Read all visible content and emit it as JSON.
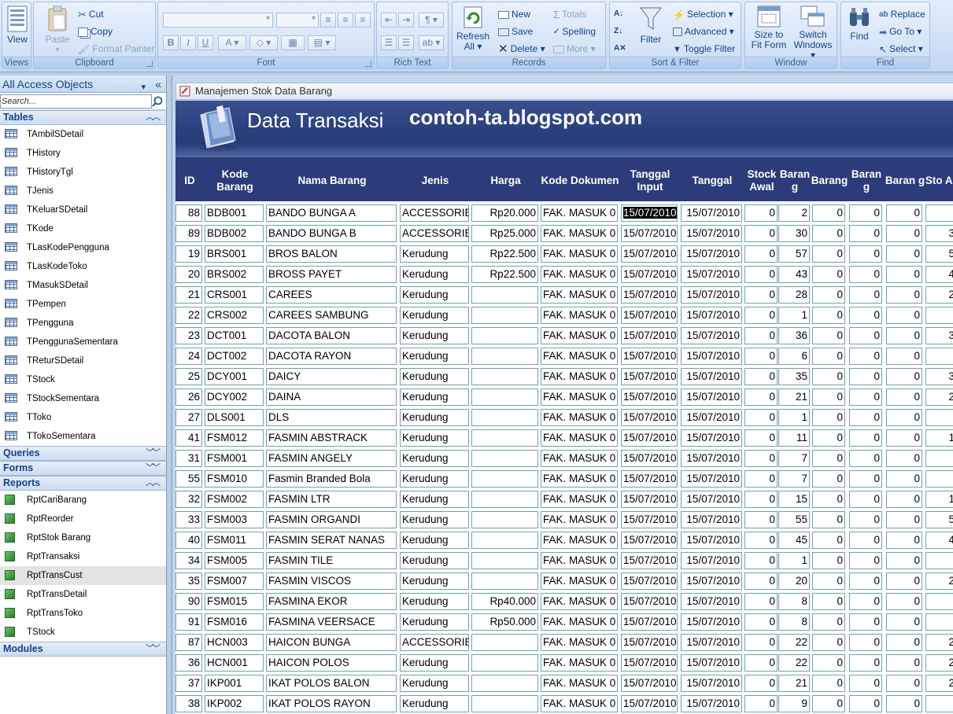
{
  "ribbon": {
    "views": {
      "label": "Views",
      "view_label": "View"
    },
    "clipboard": {
      "label": "Clipboard",
      "paste": "Paste",
      "cut": "Cut",
      "copy": "Copy",
      "format_painter": "Format Painter"
    },
    "font": {
      "label": "Font"
    },
    "rich_text": {
      "label": "Rich Text"
    },
    "records": {
      "label": "Records",
      "refresh": "Refresh",
      "refresh_sub": "All",
      "new": "New",
      "save": "Save",
      "delete": "Delete",
      "totals": "Totals",
      "spelling": "Spelling",
      "more": "More"
    },
    "sort_filter": {
      "label": "Sort & Filter",
      "filter": "Filter",
      "selection": "Selection",
      "advanced": "Advanced",
      "toggle_filter": "Toggle Filter"
    },
    "window": {
      "label": "Window",
      "size_to_fit": "Size to",
      "size_to_fit_2": "Fit Form",
      "switch_windows": "Switch",
      "switch_windows_2": "Windows"
    },
    "find": {
      "label": "Find",
      "find": "Find",
      "replace": "Replace",
      "go_to": "Go To",
      "select": "Select"
    }
  },
  "nav": {
    "header": "All Access Objects",
    "search_placeholder": "Search...",
    "sections": {
      "tables": "Tables",
      "queries": "Queries",
      "forms": "Forms",
      "reports": "Reports",
      "modules": "Modules"
    },
    "tables": [
      "TAmbilSDetail",
      "THistory",
      "THistoryTgl",
      "TJenis",
      "TKeluarSDetail",
      "TKode",
      "TLasKodePengguna",
      "TLasKodeToko",
      "TMasukSDetail",
      "TPempen",
      "TPengguna",
      "TPenggunaSementara",
      "TReturSDetail",
      "TStock",
      "TStockSementara",
      "TToko",
      "TTokoSementara"
    ],
    "reports": [
      "RptCariBarang",
      "RptReorder",
      "RptStok Barang",
      "RptTransaksi",
      "RptTransCust",
      "RptTransDetail",
      "RptTransToko",
      "TStock"
    ],
    "selected_report": "RptTransCust"
  },
  "doc": {
    "tab_title": "Manajemen Stok Data Barang",
    "form_title": "Data Transaksi",
    "form_subtitle": "contoh-ta.blogspot.com"
  },
  "grid": {
    "columns": [
      {
        "key": "id",
        "label": "ID"
      },
      {
        "key": "kode",
        "label": "Kode Barang"
      },
      {
        "key": "nama",
        "label": "Nama Barang"
      },
      {
        "key": "jenis",
        "label": "Jenis"
      },
      {
        "key": "harga",
        "label": "Harga"
      },
      {
        "key": "dok",
        "label": "Kode Dokumen"
      },
      {
        "key": "tgl_input",
        "label": "Tanggal Input"
      },
      {
        "key": "tgl",
        "label": "Tanggal"
      },
      {
        "key": "stock_awal",
        "label": "Stock Awal"
      },
      {
        "key": "barang1",
        "label": "Baran g"
      },
      {
        "key": "barang2",
        "label": "Barang"
      },
      {
        "key": "barang3",
        "label": "Baran g"
      },
      {
        "key": "barang4",
        "label": "Baran g"
      },
      {
        "key": "stock_akhir",
        "label": "Sto Ak"
      }
    ],
    "rows": [
      {
        "id": "88",
        "kode": "BDB001",
        "nama": "BANDO BUNGA A",
        "jenis": "ACCESSORIE",
        "harga": "Rp20.000",
        "dok": "FAK. MASUK 0",
        "tgl_input": "15/07/2010",
        "tgl": "15/07/2010",
        "stock_awal": "0",
        "barang1": "2",
        "barang2": "0",
        "barang3": "0",
        "barang4": "0",
        "stock_akhir": ""
      },
      {
        "id": "89",
        "kode": "BDB002",
        "nama": "BANDO BUNGA B",
        "jenis": "ACCESSORIE",
        "harga": "Rp25.000",
        "dok": "FAK. MASUK 0",
        "tgl_input": "15/07/2010",
        "tgl": "15/07/2010",
        "stock_awal": "0",
        "barang1": "30",
        "barang2": "0",
        "barang3": "0",
        "barang4": "0",
        "stock_akhir": "3"
      },
      {
        "id": "19",
        "kode": "BRS001",
        "nama": "BROS BALON",
        "jenis": "Kerudung",
        "harga": "Rp22.500",
        "dok": "FAK. MASUK 0",
        "tgl_input": "15/07/2010",
        "tgl": "15/07/2010",
        "stock_awal": "0",
        "barang1": "57",
        "barang2": "0",
        "barang3": "0",
        "barang4": "0",
        "stock_akhir": "5"
      },
      {
        "id": "20",
        "kode": "BRS002",
        "nama": "BROSS PAYET",
        "jenis": "Kerudung",
        "harga": "Rp22.500",
        "dok": "FAK. MASUK 0",
        "tgl_input": "15/07/2010",
        "tgl": "15/07/2010",
        "stock_awal": "0",
        "barang1": "43",
        "barang2": "0",
        "barang3": "0",
        "barang4": "0",
        "stock_akhir": "4"
      },
      {
        "id": "21",
        "kode": "CRS001",
        "nama": "CAREES",
        "jenis": "Kerudung",
        "harga": "",
        "dok": "FAK. MASUK 0",
        "tgl_input": "15/07/2010",
        "tgl": "15/07/2010",
        "stock_awal": "0",
        "barang1": "28",
        "barang2": "0",
        "barang3": "0",
        "barang4": "0",
        "stock_akhir": "2"
      },
      {
        "id": "22",
        "kode": "CRS002",
        "nama": "CAREES SAMBUNG",
        "jenis": "Kerudung",
        "harga": "",
        "dok": "FAK. MASUK 0",
        "tgl_input": "15/07/2010",
        "tgl": "15/07/2010",
        "stock_awal": "0",
        "barang1": "1",
        "barang2": "0",
        "barang3": "0",
        "barang4": "0",
        "stock_akhir": ""
      },
      {
        "id": "23",
        "kode": "DCT001",
        "nama": "DACOTA BALON",
        "jenis": "Kerudung",
        "harga": "",
        "dok": "FAK. MASUK 0",
        "tgl_input": "15/07/2010",
        "tgl": "15/07/2010",
        "stock_awal": "0",
        "barang1": "36",
        "barang2": "0",
        "barang3": "0",
        "barang4": "0",
        "stock_akhir": "3"
      },
      {
        "id": "24",
        "kode": "DCT002",
        "nama": "DACOTA RAYON",
        "jenis": "Kerudung",
        "harga": "",
        "dok": "FAK. MASUK 0",
        "tgl_input": "15/07/2010",
        "tgl": "15/07/2010",
        "stock_awal": "0",
        "barang1": "6",
        "barang2": "0",
        "barang3": "0",
        "barang4": "0",
        "stock_akhir": ""
      },
      {
        "id": "25",
        "kode": "DCY001",
        "nama": "DAICY",
        "jenis": "Kerudung",
        "harga": "",
        "dok": "FAK. MASUK 0",
        "tgl_input": "15/07/2010",
        "tgl": "15/07/2010",
        "stock_awal": "0",
        "barang1": "35",
        "barang2": "0",
        "barang3": "0",
        "barang4": "0",
        "stock_akhir": "3"
      },
      {
        "id": "26",
        "kode": "DCY002",
        "nama": "DAINA",
        "jenis": "Kerudung",
        "harga": "",
        "dok": "FAK. MASUK 0",
        "tgl_input": "15/07/2010",
        "tgl": "15/07/2010",
        "stock_awal": "0",
        "barang1": "21",
        "barang2": "0",
        "barang3": "0",
        "barang4": "0",
        "stock_akhir": "2"
      },
      {
        "id": "27",
        "kode": "DLS001",
        "nama": "DLS",
        "jenis": "Kerudung",
        "harga": "",
        "dok": "FAK. MASUK 0",
        "tgl_input": "15/07/2010",
        "tgl": "15/07/2010",
        "stock_awal": "0",
        "barang1": "1",
        "barang2": "0",
        "barang3": "0",
        "barang4": "0",
        "stock_akhir": ""
      },
      {
        "id": "41",
        "kode": "FSM012",
        "nama": "FASMIN ABSTRACK",
        "jenis": "Kerudung",
        "harga": "",
        "dok": "FAK. MASUK 0",
        "tgl_input": "15/07/2010",
        "tgl": "15/07/2010",
        "stock_awal": "0",
        "barang1": "11",
        "barang2": "0",
        "barang3": "0",
        "barang4": "0",
        "stock_akhir": "1"
      },
      {
        "id": "31",
        "kode": "FSM001",
        "nama": "FASMIN ANGELY",
        "jenis": "Kerudung",
        "harga": "",
        "dok": "FAK. MASUK 0",
        "tgl_input": "15/07/2010",
        "tgl": "15/07/2010",
        "stock_awal": "0",
        "barang1": "7",
        "barang2": "0",
        "barang3": "0",
        "barang4": "0",
        "stock_akhir": ""
      },
      {
        "id": "55",
        "kode": "FSM010",
        "nama": "Fasmin Branded Bola",
        "jenis": "Kerudung",
        "harga": "",
        "dok": "FAK. MASUK 0",
        "tgl_input": "15/07/2010",
        "tgl": "15/07/2010",
        "stock_awal": "0",
        "barang1": "7",
        "barang2": "0",
        "barang3": "0",
        "barang4": "0",
        "stock_akhir": ""
      },
      {
        "id": "32",
        "kode": "FSM002",
        "nama": "FASMIN LTR",
        "jenis": "Kerudung",
        "harga": "",
        "dok": "FAK. MASUK 0",
        "tgl_input": "15/07/2010",
        "tgl": "15/07/2010",
        "stock_awal": "0",
        "barang1": "15",
        "barang2": "0",
        "barang3": "0",
        "barang4": "0",
        "stock_akhir": "1"
      },
      {
        "id": "33",
        "kode": "FSM003",
        "nama": "FASMIN ORGANDI",
        "jenis": "Kerudung",
        "harga": "",
        "dok": "FAK. MASUK 0",
        "tgl_input": "15/07/2010",
        "tgl": "15/07/2010",
        "stock_awal": "0",
        "barang1": "55",
        "barang2": "0",
        "barang3": "0",
        "barang4": "0",
        "stock_akhir": "5"
      },
      {
        "id": "40",
        "kode": "FSM011",
        "nama": "FASMIN SERAT NANAS",
        "jenis": "Kerudung",
        "harga": "",
        "dok": "FAK. MASUK 0",
        "tgl_input": "15/07/2010",
        "tgl": "15/07/2010",
        "stock_awal": "0",
        "barang1": "45",
        "barang2": "0",
        "barang3": "0",
        "barang4": "0",
        "stock_akhir": "4"
      },
      {
        "id": "34",
        "kode": "FSM005",
        "nama": "FASMIN TILE",
        "jenis": "Kerudung",
        "harga": "",
        "dok": "FAK. MASUK 0",
        "tgl_input": "15/07/2010",
        "tgl": "15/07/2010",
        "stock_awal": "0",
        "barang1": "1",
        "barang2": "0",
        "barang3": "0",
        "barang4": "0",
        "stock_akhir": ""
      },
      {
        "id": "35",
        "kode": "FSM007",
        "nama": "FASMIN VISCOS",
        "jenis": "Kerudung",
        "harga": "",
        "dok": "FAK. MASUK 0",
        "tgl_input": "15/07/2010",
        "tgl": "15/07/2010",
        "stock_awal": "0",
        "barang1": "20",
        "barang2": "0",
        "barang3": "0",
        "barang4": "0",
        "stock_akhir": "2"
      },
      {
        "id": "90",
        "kode": "FSM015",
        "nama": "FASMINA EKOR",
        "jenis": "Kerudung",
        "harga": "Rp40.000",
        "dok": "FAK. MASUK 0",
        "tgl_input": "15/07/2010",
        "tgl": "15/07/2010",
        "stock_awal": "0",
        "barang1": "8",
        "barang2": "0",
        "barang3": "0",
        "barang4": "0",
        "stock_akhir": ""
      },
      {
        "id": "91",
        "kode": "FSM016",
        "nama": "FASMINA VEERSACE",
        "jenis": "Kerudung",
        "harga": "Rp50.000",
        "dok": "FAK. MASUK 0",
        "tgl_input": "15/07/2010",
        "tgl": "15/07/2010",
        "stock_awal": "0",
        "barang1": "8",
        "barang2": "0",
        "barang3": "0",
        "barang4": "0",
        "stock_akhir": ""
      },
      {
        "id": "87",
        "kode": "HCN003",
        "nama": "HAICON BUNGA",
        "jenis": "ACCESSORIE",
        "harga": "",
        "dok": "FAK. MASUK 0",
        "tgl_input": "15/07/2010",
        "tgl": "15/07/2010",
        "stock_awal": "0",
        "barang1": "22",
        "barang2": "0",
        "barang3": "0",
        "barang4": "0",
        "stock_akhir": "2"
      },
      {
        "id": "36",
        "kode": "HCN001",
        "nama": "HAICON POLOS",
        "jenis": "Kerudung",
        "harga": "",
        "dok": "FAK. MASUK 0",
        "tgl_input": "15/07/2010",
        "tgl": "15/07/2010",
        "stock_awal": "0",
        "barang1": "22",
        "barang2": "0",
        "barang3": "0",
        "barang4": "0",
        "stock_akhir": "2"
      },
      {
        "id": "37",
        "kode": "IKP001",
        "nama": "IKAT POLOS BALON",
        "jenis": "Kerudung",
        "harga": "",
        "dok": "FAK. MASUK 0",
        "tgl_input": "15/07/2010",
        "tgl": "15/07/2010",
        "stock_awal": "0",
        "barang1": "21",
        "barang2": "0",
        "barang3": "0",
        "barang4": "0",
        "stock_akhir": "2"
      },
      {
        "id": "38",
        "kode": "IKP002",
        "nama": "IKAT POLOS RAYON",
        "jenis": "Kerudung",
        "harga": "",
        "dok": "FAK. MASUK 0",
        "tgl_input": "15/07/2010",
        "tgl": "15/07/2010",
        "stock_awal": "0",
        "barang1": "9",
        "barang2": "0",
        "barang3": "0",
        "barang4": "0",
        "stock_akhir": ""
      }
    ]
  },
  "colors": {
    "header_bg": "#2c3c7a",
    "cell_border": "#6fa3a8",
    "ribbon_text": "#15428b"
  }
}
